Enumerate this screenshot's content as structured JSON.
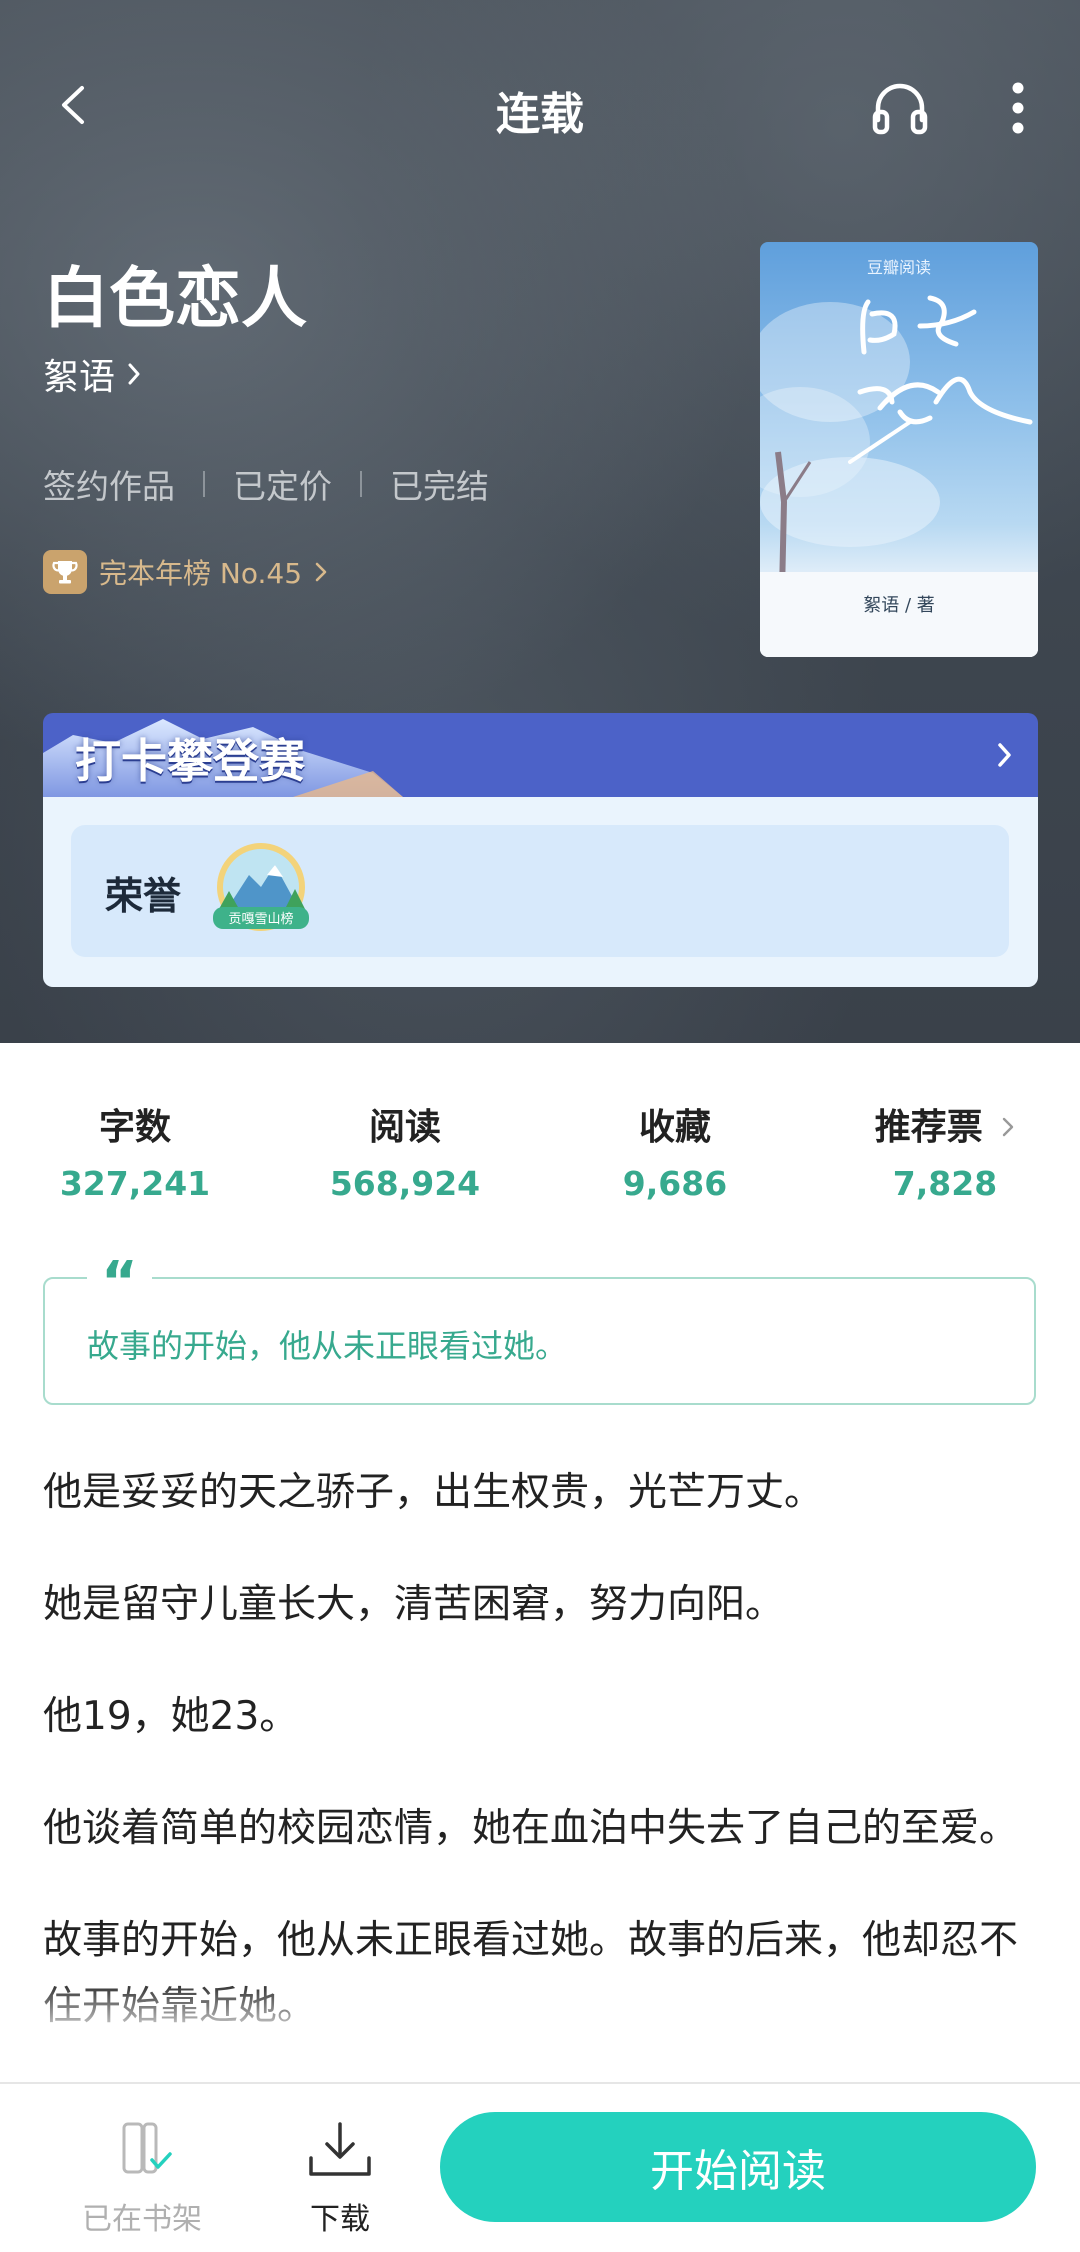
{
  "header": {
    "title": "连载"
  },
  "book": {
    "title": "白色恋人",
    "author": "絮语",
    "tags": [
      "签约作品",
      "已定价",
      "已完结"
    ],
    "rank": "完本年榜 No.45",
    "cover": {
      "brand": "豆瓣阅读",
      "title_art": "白色恋人",
      "author_line": "絮语 / 著"
    }
  },
  "event": {
    "title": "打卡攀登赛",
    "honor_label": "荣誉",
    "badge_text": "贡嘎雪山榜"
  },
  "stats": [
    {
      "label": "字数",
      "value": "327,241"
    },
    {
      "label": "阅读",
      "value": "568,924"
    },
    {
      "label": "收藏",
      "value": "9,686"
    },
    {
      "label": "推荐票",
      "value": "7,828"
    }
  ],
  "quote": {
    "mark": "“",
    "text": "故事的开始，他从未正眼看过她。"
  },
  "synopsis": [
    "他是妥妥的天之骄子，出生权贵，光芒万丈。",
    "她是留守儿童长大，清苦困窘，努力向阳。",
    "他19，她23。",
    "他谈着简单的校园恋情，她在血泊中失去了自己的至爱。",
    "故事的开始，他从未正眼看过她。故事的后来，他却忍不住开始靠近她。"
  ],
  "bottom_bar": {
    "shelf_label": "已在书架",
    "download_label": "下载",
    "start_label": "开始阅读"
  },
  "colors": {
    "accent": "#24d1be",
    "stat_value": "#37a98e",
    "event_blue": "#4c62c8",
    "rank_gold": "#d8b98c"
  }
}
